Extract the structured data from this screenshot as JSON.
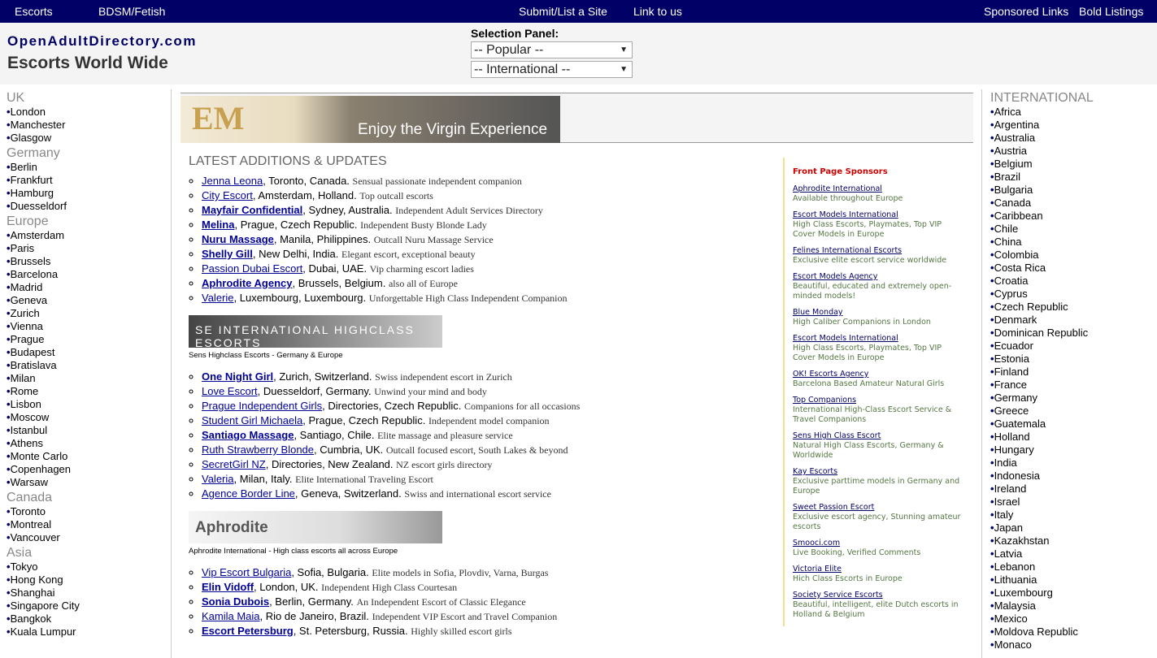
{
  "nav": {
    "escorts": "Escorts",
    "bdsm": "BDSM/Fetish",
    "submit": "Submit/List a Site",
    "link": "Link to us",
    "sponsored": "Sponsored Links",
    "bold": "Bold Listings"
  },
  "header": {
    "logo": "OpenAdultDirectory.com",
    "tagline": "Escorts World Wide",
    "selection_label": "Selection Panel:",
    "select1": "-- Popular --",
    "select2": "-- International --"
  },
  "left": [
    {
      "group": "UK",
      "cities": [
        "London",
        "Manchester",
        "Glasgow"
      ]
    },
    {
      "group": "Germany",
      "cities": [
        "Berlin",
        "Frankfurt",
        "Hamburg",
        "Duesseldorf"
      ]
    },
    {
      "group": "Europe",
      "cities": [
        "Amsterdam",
        "Paris",
        "Brussels",
        "Barcelona",
        "Madrid",
        "Geneva",
        "Zurich",
        "Vienna",
        "Prague",
        "Budapest",
        "Bratislava",
        "Milan",
        "Rome",
        "Lisbon",
        "Moscow",
        "Istanbul",
        "Athens",
        "Monte Carlo",
        "Copenhagen",
        "Warsaw"
      ]
    },
    {
      "group": "Canada",
      "cities": [
        "Toronto",
        "Montreal",
        "Vancouver"
      ]
    },
    {
      "group": "Asia",
      "cities": [
        "Tokyo",
        "Hong Kong",
        "Shanghai",
        "Singapore City",
        "Bangkok",
        "Kuala Lumpur"
      ]
    }
  ],
  "right": {
    "group": "INTERNATIONAL",
    "countries": [
      "Africa",
      "Argentina",
      "Australia",
      "Austria",
      "Belgium",
      "Brazil",
      "Bulgaria",
      "Canada",
      "Caribbean",
      "Chile",
      "China",
      "Colombia",
      "Costa Rica",
      "Croatia",
      "Cyprus",
      "Czech Republic",
      "Denmark",
      "Dominican Republic",
      "Ecuador",
      "Estonia",
      "Finland",
      "France",
      "Germany",
      "Greece",
      "Guatemala",
      "Holland",
      "Hungary",
      "India",
      "Indonesia",
      "Ireland",
      "Israel",
      "Italy",
      "Japan",
      "Kazakhstan",
      "Latvia",
      "Lebanon",
      "Lithuania",
      "Luxembourg",
      "Malaysia",
      "Mexico",
      "Moldova Republic",
      "Monaco"
    ]
  },
  "main": {
    "banner": {
      "mark": "EM",
      "text": "Enjoy the Virgin Experience"
    },
    "title": "LATEST ADDITIONS & UPDATES",
    "lists": [
      [
        {
          "name": "Jenna Leona",
          "bold": false,
          "loc": ", Toronto, Canada.",
          "desc": "Sensual passionate independent companion"
        },
        {
          "name": "City Escort",
          "bold": false,
          "loc": ", Amsterdam, Holland.",
          "desc": "Top outcall escorts"
        },
        {
          "name": "Mayfair Confidential",
          "bold": true,
          "loc": ", Sydney, Australia.",
          "desc": "Independent Adult Services Directory"
        },
        {
          "name": "Melina",
          "bold": true,
          "loc": ", Prague, Czech Republic.",
          "desc": "Independent Busty Blonde Lady"
        },
        {
          "name": "Nuru Massage",
          "bold": true,
          "loc": ", Manila, Philippines.",
          "desc": "Outcall Nuru Massage Service"
        },
        {
          "name": "Shelly Gill",
          "bold": true,
          "loc": ", New Delhi, India.",
          "desc": "Elegant escort, exceptional beauty"
        },
        {
          "name": "Passion Dubai Escort",
          "bold": false,
          "loc": ", Dubai, UAE.",
          "desc": "Vip charming escort ladies"
        },
        {
          "name": "Aphrodite Agency",
          "bold": true,
          "loc": ", Brussels, Belgium.",
          "desc": "also all of Europe"
        },
        {
          "name": "Valerie",
          "bold": false,
          "loc": ", Luxembourg, Luxembourg.",
          "desc": "Unforgettable High Class Independent Companion"
        }
      ],
      [
        {
          "name": "One Night Girl",
          "bold": true,
          "loc": ", Zurich, Switzerland.",
          "desc": "Swiss independent escort in Zurich"
        },
        {
          "name": "Love Escort",
          "bold": false,
          "loc": ", Duesseldorf, Germany.",
          "desc": "Unwind your mind and body"
        },
        {
          "name": "Prague Independent Girls",
          "bold": false,
          "loc": ", Directories, Czech Republic.",
          "desc": "Companions for all occasions"
        },
        {
          "name": "Student Girl Michaela",
          "bold": false,
          "loc": ", Prague, Czech Republic.",
          "desc": "Independent model companion"
        },
        {
          "name": "Santiago Massage",
          "bold": true,
          "loc": ", Santiago, Chile.",
          "desc": "Elite massage and pleasure service"
        },
        {
          "name": "Ruth Strawberry Blonde",
          "bold": false,
          "loc": ", Cumbria, UK.",
          "desc": "Outcall focused escort, South Lakes & beyond"
        },
        {
          "name": "SecretGirl NZ",
          "bold": false,
          "loc": ", Directories, New Zealand.",
          "desc": "NZ escort girls directory"
        },
        {
          "name": "Valeria",
          "bold": false,
          "loc": ", Milan, Italy.",
          "desc": "Elite International Traveling Escort"
        },
        {
          "name": "Agence Border Line",
          "bold": false,
          "loc": ", Geneva, Switzerland.",
          "desc": "Swiss and international escort service"
        }
      ],
      [
        {
          "name": "Vip Escort Bulgaria",
          "bold": false,
          "loc": ", Sofia, Bulgaria.",
          "desc": "Elite models in Sofia, Plovdiv, Varna, Burgas"
        },
        {
          "name": "Elin Vidoff",
          "bold": true,
          "loc": ", London, UK.",
          "desc": "Independent High Class Courtesan"
        },
        {
          "name": "Sonia Dubois",
          "bold": true,
          "loc": ", Berlin, Germany.",
          "desc": "An Independent Escort of Classic Elegance"
        },
        {
          "name": "Kamila Maia",
          "bold": false,
          "loc": ", Rio de Janeiro, Brazil.",
          "desc": "Independent VIP Escort and Travel Companion"
        },
        {
          "name": "Escort Petersburg",
          "bold": true,
          "loc": ", St. Petersburg, Russia.",
          "desc": "Highly skilled escort girls"
        }
      ]
    ],
    "ads": [
      {
        "img_text": "SE  INTERNATIONAL HIGHCLASS ESCORTS",
        "caption": "Sens Highclass Escorts - Germany & Europe"
      },
      {
        "img_text": "Aphrodite",
        "caption": "Aphrodite International - High class escorts all across Europe"
      }
    ]
  },
  "sponsors": {
    "title": "Front Page Sponsors",
    "items": [
      {
        "name": "Aphrodite International",
        "desc": "Available throughout Europe"
      },
      {
        "name": "Escort Models International",
        "desc": "High Class Escorts, Playmates, Top VIP Cover Models in Europe"
      },
      {
        "name": "Felines International Escorts",
        "desc": "Exclusive elite escort service worldwide"
      },
      {
        "name": "Escort Models Agency",
        "desc": "Beautiful, educated and extremely open-minded models!"
      },
      {
        "name": "Blue Monday",
        "desc": "High Caliber Companions in London"
      },
      {
        "name": "Escort Models International",
        "desc": "High Class Escorts, Playmates, Top VIP Cover Models in Europe"
      },
      {
        "name": "OK! Escorts Agency",
        "desc": "Barcelona Based Amateur Natural Girls"
      },
      {
        "name": "Top Companions",
        "desc": "International High-Class Escort Service & Travel Companions"
      },
      {
        "name": "Sens High Class Escort",
        "desc": "Natural High Class Escorts, Germany & Worldwide"
      },
      {
        "name": "Kay Escorts",
        "desc": "Exclusive parttime models in Germany and Europe"
      },
      {
        "name": "Sweet Passion Escort",
        "desc": "Exclusive escort agency, Stunning amateur escorts"
      },
      {
        "name": "Smooci.com",
        "desc": "Live Booking, Verified Comments"
      },
      {
        "name": "Victoria Elite",
        "desc": "Hich Class Escorts in Europe"
      },
      {
        "name": "Society Service Escorts",
        "desc": "Beautiful, intelligent, elite Dutch escorts in Holland & Belgium"
      }
    ]
  }
}
